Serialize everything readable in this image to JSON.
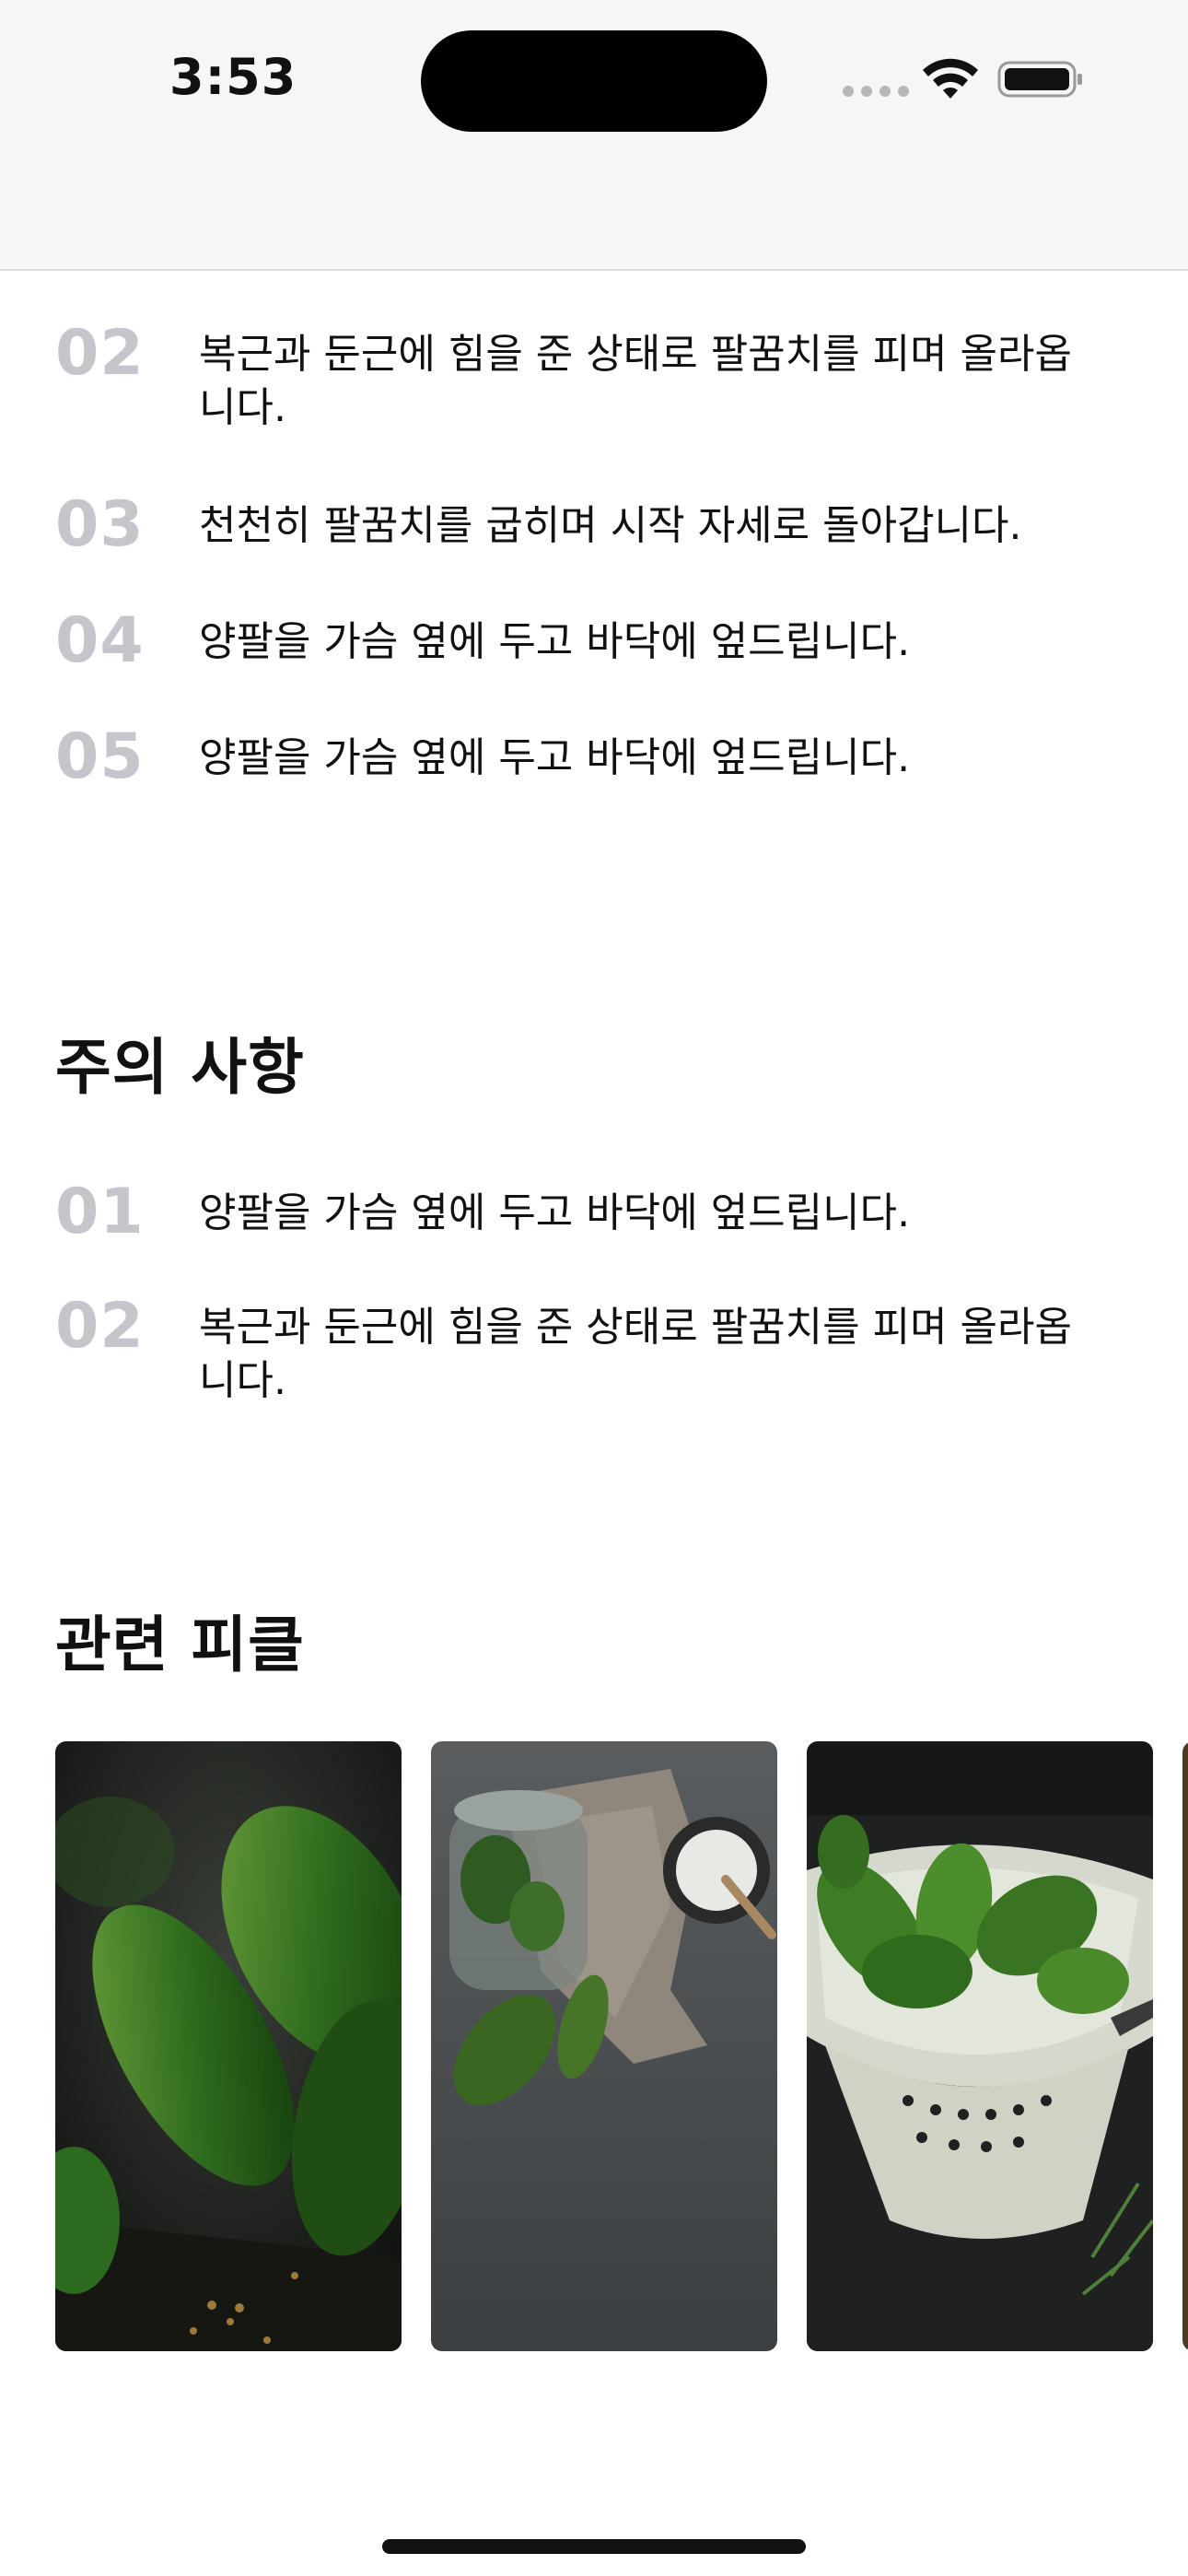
{
  "status_bar": {
    "time": "3:53"
  },
  "steps": [
    {
      "number": "02",
      "text": "복근과 둔근에 힘을 준 상태로 팔꿈치를 피며 올라옵니다."
    },
    {
      "number": "03",
      "text": "천천히 팔꿈치를 굽히며 시작 자세로 돌아갑니다."
    },
    {
      "number": "04",
      "text": "양팔을 가슴 옆에 두고 바닥에 엎드립니다."
    },
    {
      "number": "05",
      "text": "양팔을 가슴 옆에 두고 바닥에 엎드립니다."
    }
  ],
  "cautions": {
    "title": "주의 사항",
    "items": [
      {
        "number": "01",
        "text": "양팔을 가슴 옆에 두고 바닥에 엎드립니다."
      },
      {
        "number": "02",
        "text": "복근과 둔근에 힘을 준 상태로 팔꿈치를 피며 올라옵니다."
      }
    ]
  },
  "related": {
    "title": "관련 피클",
    "cards": [
      {
        "image": "pickles-on-wood"
      },
      {
        "image": "pickles-jar-and-salt"
      },
      {
        "image": "pickles-in-colander"
      },
      {
        "image": "pickles-partial"
      }
    ]
  },
  "colors": {
    "step_number": "#c4c6cc",
    "text": "#111111",
    "status_bg": "#f6f6f6"
  }
}
